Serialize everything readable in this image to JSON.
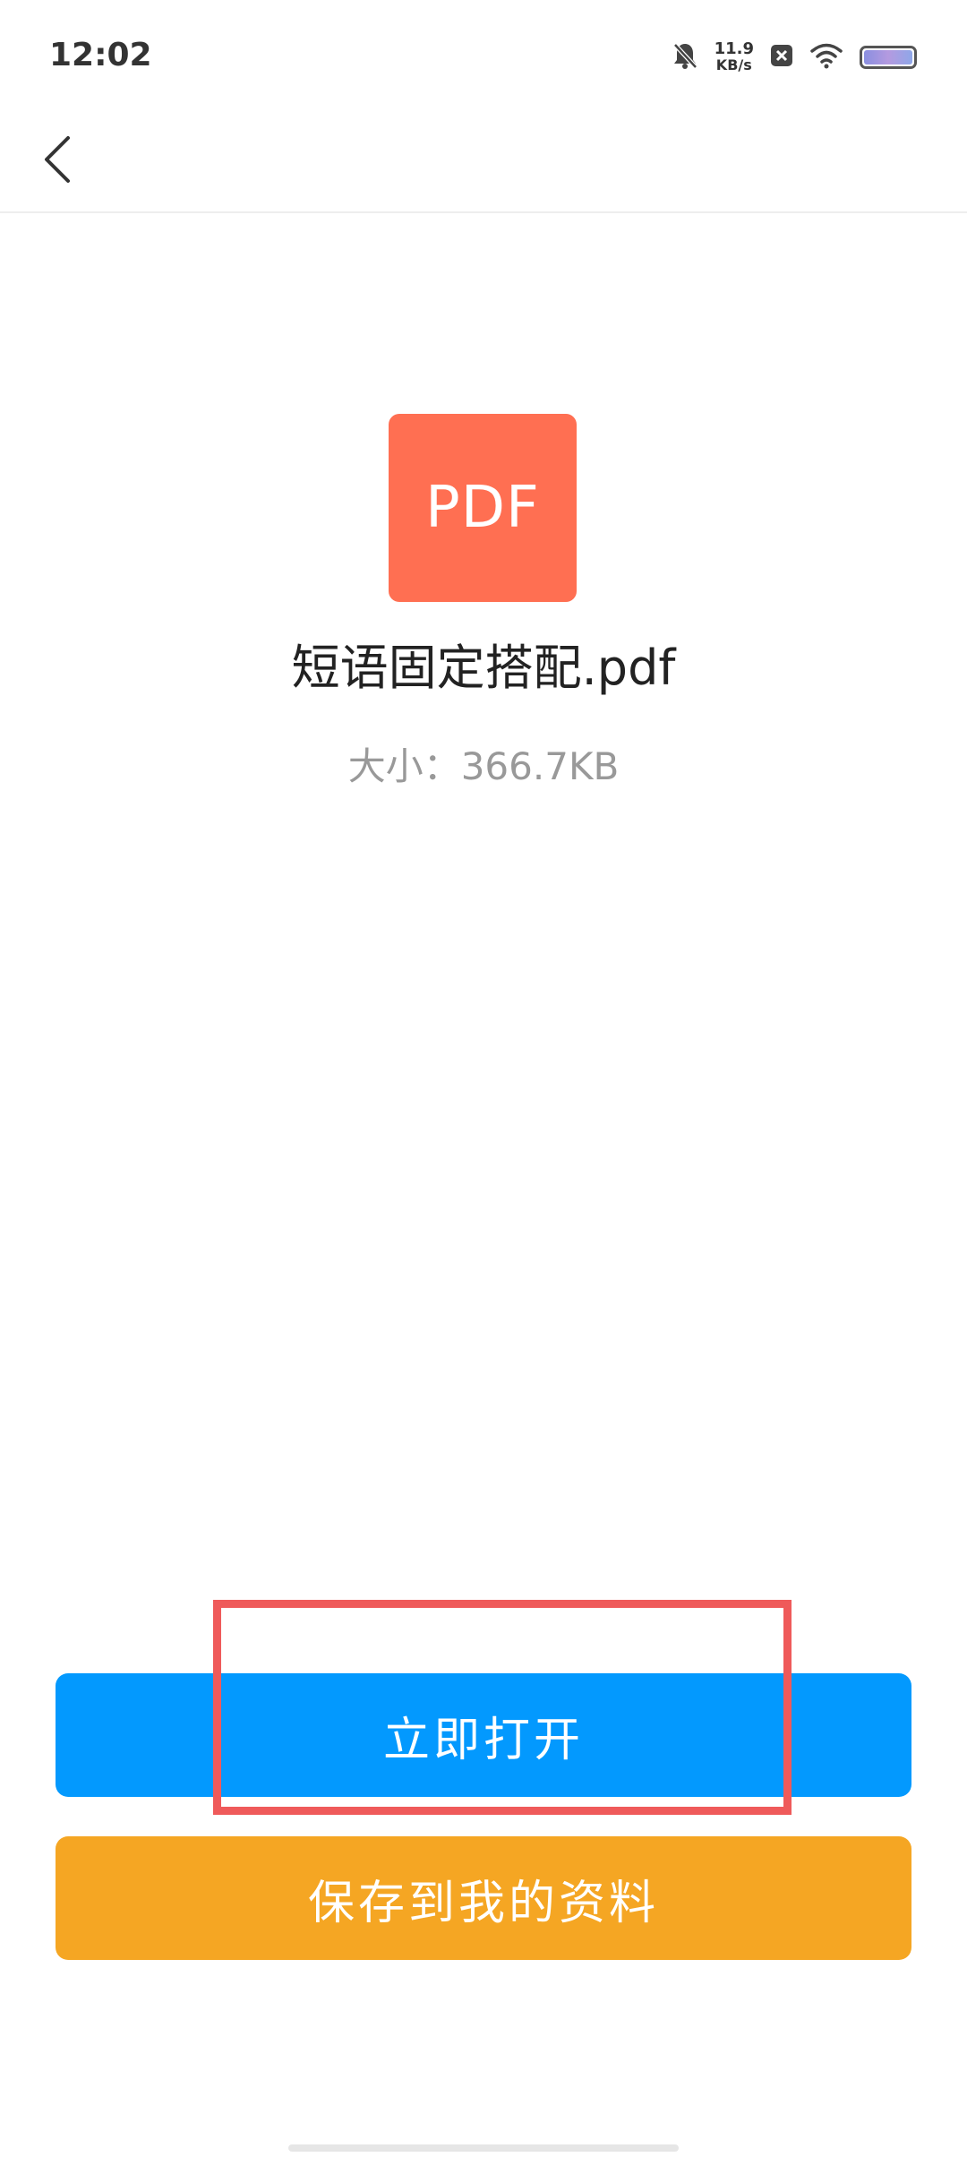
{
  "status_bar": {
    "time": "12:02",
    "net_speed_value": "11.9",
    "net_speed_unit": "KB/s",
    "icons": [
      "bell-muted-icon",
      "close-badge-icon",
      "wifi-icon",
      "battery-icon"
    ]
  },
  "file": {
    "icon_label": "PDF",
    "name": "短语固定搭配.pdf",
    "size": "大小：366.7KB"
  },
  "actions": {
    "open_label": "立即打开",
    "save_label": "保存到我的资料"
  },
  "colors": {
    "pdf_icon": "#ff6f52",
    "open_button": "#0399fe",
    "save_button": "#f5a623",
    "highlight": "#ef5a5a"
  }
}
